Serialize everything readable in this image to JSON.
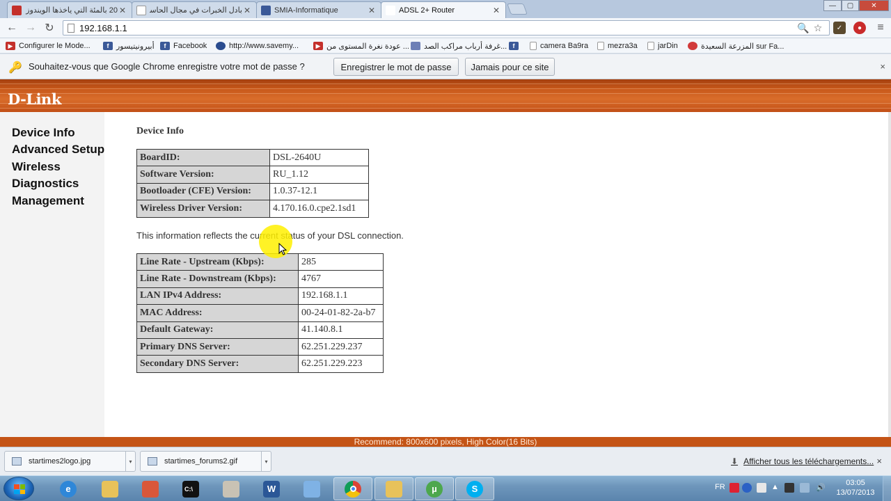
{
  "browser": {
    "tabs": [
      {
        "title": "20 بالمئة التي ياخذها الويندوز",
        "fav_color": "#c4302b"
      },
      {
        "title": "بادل الخبرات في مجال الحاسب",
        "fav_color": "#ffffff"
      },
      {
        "title": "SMIA-Informatique",
        "fav_color": "#3b5998"
      },
      {
        "title": "ADSL 2+ Router",
        "fav_color": "#ffffff"
      }
    ],
    "address": "192.168.1.1",
    "bookmarks": [
      {
        "label": "Configurer le Mode...",
        "icon": "youtube-icon"
      },
      {
        "label": "أبيرونيتيسور",
        "icon": "facebook-icon"
      },
      {
        "label": "Facebook",
        "icon": "facebook-icon"
      },
      {
        "label": "http://www.savemy...",
        "icon": "shield-icon"
      },
      {
        "label": "عودة نغرة المستوى من ...",
        "icon": "youtube-icon"
      },
      {
        "label": "غرفة أرباب مراكب الصد...",
        "icon": "arabic-site-icon"
      },
      {
        "label": "",
        "icon": "facebook-icon"
      },
      {
        "label": "camera Ba9ra",
        "icon": "page-icon"
      },
      {
        "label": "mezra3a",
        "icon": "page-icon"
      },
      {
        "label": "jarDin",
        "icon": "page-icon"
      },
      {
        "label": "المزرعة السعيدة sur Fa...",
        "icon": "farm-icon"
      }
    ],
    "infobar": {
      "message": "Souhaitez-vous que Google Chrome enregistre votre mot de passe ?",
      "save_label": "Enregistrer le mot de passe",
      "never_label": "Jamais pour ce site",
      "close": "×"
    },
    "downloads": [
      {
        "name": "startimes2logo.jpg"
      },
      {
        "name": "startimes_forums2.gif"
      }
    ],
    "show_all_downloads": "Afficher tous les téléchargements...",
    "shelf_close": "×"
  },
  "router": {
    "logo": "D-Link",
    "nav": [
      "Device Info",
      "Advanced Setup",
      "Wireless",
      "Diagnostics",
      "Management"
    ],
    "section_title": "Device Info",
    "device_table": [
      {
        "key": "BoardID:",
        "value": "DSL-2640U"
      },
      {
        "key": "Software Version:",
        "value": "RU_1.12"
      },
      {
        "key": "Bootloader (CFE) Version:",
        "value": "1.0.37-12.1"
      },
      {
        "key": "Wireless Driver Version:",
        "value": "4.170.16.0.cpe2.1sd1"
      }
    ],
    "status_note": "This information reflects the current status of your DSL connection.",
    "status_table": [
      {
        "key": "Line Rate - Upstream (Kbps):",
        "value": "285"
      },
      {
        "key": "Line Rate - Downstream (Kbps):",
        "value": "4767"
      },
      {
        "key": "LAN IPv4 Address:",
        "value": "192.168.1.1"
      },
      {
        "key": "MAC Address:",
        "value": "00-24-01-82-2a-b7"
      },
      {
        "key": "Default Gateway:",
        "value": "41.140.8.1"
      },
      {
        "key": "Primary DNS Server:",
        "value": "62.251.229.237"
      },
      {
        "key": "Secondary DNS Server:",
        "value": "62.251.229.223"
      }
    ],
    "footer": "Recommend: 800x600 pixels, High Color(16 Bits)"
  },
  "taskbar": {
    "language": "FR",
    "time": "03:05",
    "date": "13/07/2013",
    "apps": [
      "internet-explorer-icon",
      "folder-icon",
      "media-icon",
      "cmd-icon",
      "archive-icon",
      "word-icon",
      "paint-icon",
      "chrome-icon",
      "explorer-icon",
      "utorrent-icon",
      "skype-icon"
    ],
    "utorrent_label": "µ",
    "skype_label": "S",
    "word_label": "W"
  },
  "colors": {
    "brand_orange": "#c8581a",
    "table_key_bg": "#d6d6d6"
  }
}
